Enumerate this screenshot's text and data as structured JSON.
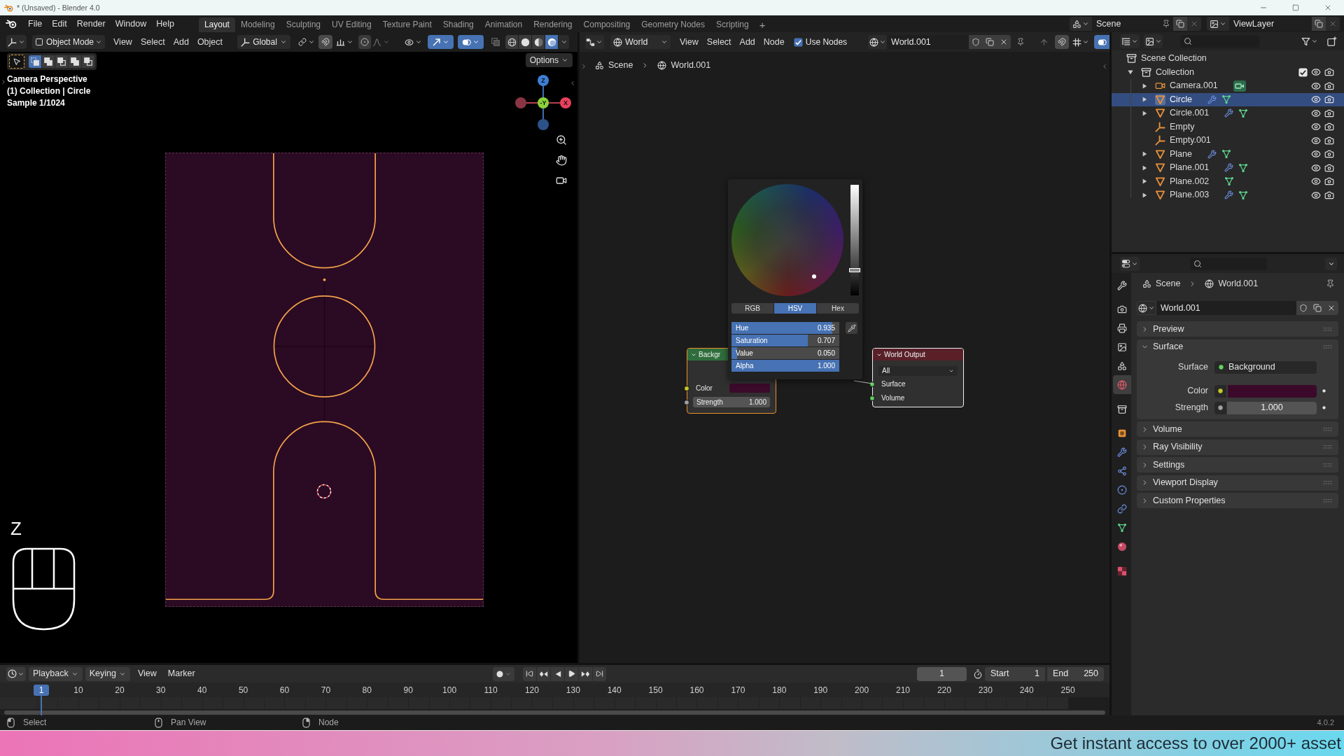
{
  "window": {
    "title": "* (Unsaved) - Blender 4.0"
  },
  "menu": [
    "File",
    "Edit",
    "Render",
    "Window",
    "Help"
  ],
  "workspaces": [
    {
      "label": "Layout",
      "selected": true
    },
    {
      "label": "Modeling",
      "selected": false
    },
    {
      "label": "Sculpting",
      "selected": false
    },
    {
      "label": "UV Editing",
      "selected": false
    },
    {
      "label": "Texture Paint",
      "selected": false
    },
    {
      "label": "Shading",
      "selected": false
    },
    {
      "label": "Animation",
      "selected": false
    },
    {
      "label": "Rendering",
      "selected": false
    },
    {
      "label": "Compositing",
      "selected": false
    },
    {
      "label": "Geometry Nodes",
      "selected": false
    },
    {
      "label": "Scripting",
      "selected": false
    }
  ],
  "add_workspace": "+",
  "scene": "Scene",
  "view_layer": "ViewLayer",
  "viewport": {
    "mode": "Object Mode",
    "menus": [
      "View",
      "Select",
      "Add",
      "Object"
    ],
    "orientation": "Global",
    "select_modes": [
      {
        "selected": true
      },
      {
        "selected": false
      },
      {
        "selected": false
      },
      {
        "selected": false
      },
      {
        "selected": false
      }
    ],
    "gizmos": {
      "on": true
    },
    "overlays": {
      "on": true
    },
    "shading": [
      {
        "kind": "wireframe",
        "selected": false
      },
      {
        "kind": "solid",
        "selected": false
      },
      {
        "kind": "material",
        "selected": false
      },
      {
        "kind": "rendered",
        "selected": true
      }
    ],
    "options": "Options",
    "info": [
      "Camera Perspective",
      "(1) Collection | Circle",
      "Sample 1/1024"
    ],
    "axes": {
      "z": "Z",
      "y": "-Y",
      "x": "X"
    },
    "pressed_key": "Z"
  },
  "node_editor": {
    "shader_type": "World",
    "menus": [
      "View",
      "Select",
      "Add",
      "Node"
    ],
    "use_nodes": {
      "label": "Use Nodes",
      "checked": true
    },
    "world": "World.001",
    "overlays": {
      "on": true
    },
    "breadcrumb": [
      "Scene",
      "World.001"
    ],
    "nodes": [
      {
        "kind": "background",
        "title": "Backgr",
        "selected": true,
        "active": false,
        "inputs": [
          {
            "kind": "color",
            "label": "Color",
            "color": "#3b0a2b"
          },
          {
            "kind": "number",
            "label": "Strength",
            "value": "1.000"
          }
        ]
      },
      {
        "kind": "output",
        "title": "World Output",
        "selected": true,
        "active": true,
        "target": "All",
        "inputs": [
          {
            "kind": "shader",
            "label": "Surface"
          },
          {
            "kind": "shader",
            "label": "Volume"
          }
        ]
      }
    ],
    "color_picker": {
      "value_slider": {
        "level": 0.22
      },
      "modes": [
        {
          "label": "RGB",
          "selected": false
        },
        {
          "label": "HSV",
          "selected": true
        },
        {
          "label": "Hex",
          "selected": false
        }
      ],
      "fields": [
        {
          "label": "Hue",
          "value": "0.935",
          "level": 0.935
        },
        {
          "label": "Saturation",
          "value": "0.707",
          "level": 0.707
        },
        {
          "label": "Value",
          "value": "0.050",
          "level": 0.05
        },
        {
          "label": "Alpha",
          "value": "1.000",
          "level": 1
        }
      ]
    }
  },
  "outliner": {
    "root": {
      "label": "Scene Collection",
      "selected": false,
      "children": [
        {
          "label": "Collection",
          "selected": false,
          "expanded": true,
          "checked": true,
          "visible": true,
          "renderable": true,
          "children": [
            {
              "label": "Camera.001",
              "kind": "camera",
              "expanded": false,
              "selected": false,
              "modifiers": false,
              "visible": true,
              "renderable": true
            },
            {
              "label": "Circle",
              "kind": "mesh",
              "expanded": false,
              "selected": true,
              "modifiers": true,
              "visible": true,
              "renderable": true
            },
            {
              "label": "Circle.001",
              "kind": "mesh",
              "expanded": false,
              "selected": false,
              "modifiers": true,
              "visible": true,
              "renderable": true
            },
            {
              "label": "Empty",
              "kind": "empty",
              "selected": false,
              "modifiers": false,
              "visible": true,
              "renderable": true
            },
            {
              "label": "Empty.001",
              "kind": "empty",
              "selected": false,
              "modifiers": false,
              "visible": true,
              "renderable": true
            },
            {
              "label": "Plane",
              "kind": "mesh",
              "expanded": false,
              "selected": false,
              "modifiers": true,
              "visible": true,
              "renderable": true
            },
            {
              "label": "Plane.001",
              "kind": "mesh",
              "expanded": false,
              "selected": false,
              "modifiers": true,
              "visible": true,
              "renderable": true
            },
            {
              "label": "Plane.002",
              "kind": "mesh",
              "expanded": false,
              "selected": false,
              "modifiers": false,
              "visible": true,
              "renderable": true
            },
            {
              "label": "Plane.003",
              "kind": "mesh",
              "expanded": false,
              "selected": false,
              "modifiers": true,
              "visible": true,
              "renderable": true
            }
          ]
        }
      ]
    }
  },
  "properties": {
    "tabs": [
      {
        "kind": "tool",
        "selected": false
      },
      {
        "kind": "render",
        "selected": false
      },
      {
        "kind": "output",
        "selected": false
      },
      {
        "kind": "view_layer",
        "selected": false
      },
      {
        "kind": "scene",
        "selected": false
      },
      {
        "kind": "world",
        "selected": true
      },
      {
        "kind": "collection",
        "selected": false
      },
      {
        "kind": "object",
        "selected": false
      },
      {
        "kind": "modifiers",
        "selected": false
      },
      {
        "kind": "particles",
        "selected": false
      },
      {
        "kind": "physics",
        "selected": false
      },
      {
        "kind": "constraints",
        "selected": false
      },
      {
        "kind": "data",
        "selected": false
      },
      {
        "kind": "material",
        "selected": false
      },
      {
        "kind": "texture",
        "selected": false
      }
    ],
    "breadcrumb": [
      "Scene",
      "World.001"
    ],
    "world": "World.001",
    "panels": [
      {
        "title": "Preview",
        "expanded": false
      },
      {
        "title": "Surface",
        "expanded": true,
        "rows": [
          {
            "kind": "shader",
            "label": "Surface",
            "value": "Background"
          },
          {
            "kind": "color",
            "label": "Color",
            "color": "#3b0a2b"
          },
          {
            "kind": "number",
            "label": "Strength",
            "value": "1.000"
          }
        ]
      },
      {
        "title": "Volume",
        "expanded": false
      },
      {
        "title": "Ray Visibility",
        "expanded": false
      },
      {
        "title": "Settings",
        "expanded": false
      },
      {
        "title": "Viewport Display",
        "expanded": false
      },
      {
        "title": "Custom Properties",
        "expanded": false
      }
    ]
  },
  "timeline": {
    "menus": [
      {
        "label": "Playback",
        "kind": "dropdown"
      },
      {
        "label": "Keying",
        "kind": "dropdown"
      },
      {
        "label": "View",
        "kind": "menu"
      },
      {
        "label": "Marker",
        "kind": "menu"
      }
    ],
    "auto_keying": {
      "on": false
    },
    "current_frame": "1",
    "start": {
      "label": "Start",
      "value": "1"
    },
    "end": {
      "label": "End",
      "value": "250"
    },
    "playhead": "1",
    "ruler": [
      "10",
      "20",
      "30",
      "40",
      "50",
      "60",
      "70",
      "80",
      "90",
      "100",
      "110",
      "120",
      "130",
      "140",
      "150",
      "160",
      "170",
      "180",
      "190",
      "200",
      "210",
      "220",
      "230",
      "240",
      "250"
    ]
  },
  "status_bar": {
    "hints": [
      {
        "kind": "left",
        "label": "Select"
      },
      {
        "kind": "middle",
        "label": "Pan View"
      },
      {
        "kind": "right",
        "label": "Node"
      }
    ],
    "version": "4.0.2"
  },
  "promo_banner": {
    "text": "Get instant access to over 2000+ asset"
  }
}
